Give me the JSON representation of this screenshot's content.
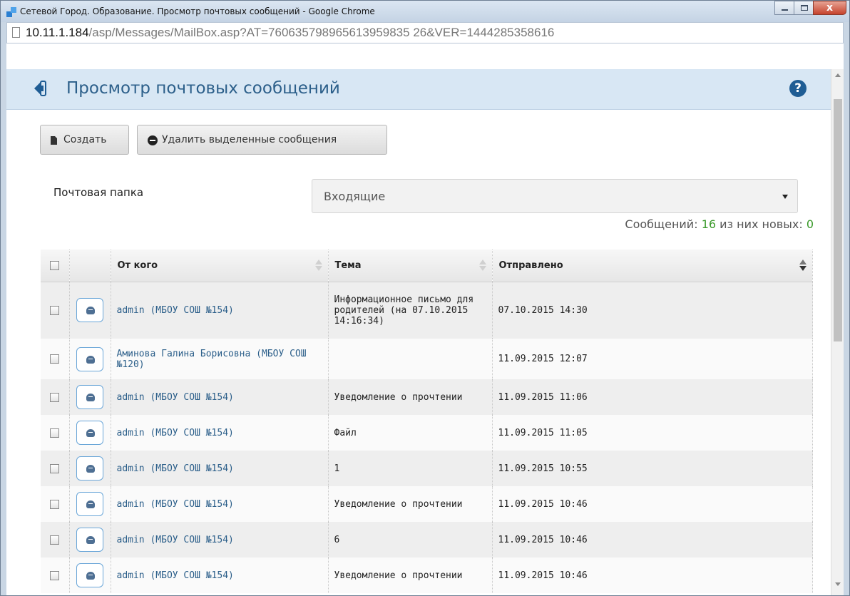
{
  "window": {
    "title": "Сетевой Город. Образование. Просмотр почтовых сообщений - Google Chrome"
  },
  "address": {
    "host": "10.11.1.184",
    "path": "/asp/Messages/MailBox.asp?AT=760635798965613959835 26&VER=1444285358616"
  },
  "page": {
    "title": "Просмотр почтовых сообщений",
    "help": "?"
  },
  "toolbar": {
    "create_label": "Создать",
    "delete_label": "Удалить выделенные сообщения"
  },
  "folder": {
    "label": "Почтовая папка",
    "selected": "Входящие"
  },
  "counts": {
    "messages_label": "Сообщений:",
    "messages_total": "16",
    "new_label": "из них новых:",
    "new_count": "0"
  },
  "table": {
    "columns": {
      "from": "От кого",
      "subject": "Тема",
      "sent": "Отправлено"
    },
    "rows": [
      {
        "from": "admin (МБОУ СОШ №154)",
        "subject": "Информационное письмо для родителей (на 07.10.2015 14:16:34)",
        "sent": "07.10.2015 14:30"
      },
      {
        "from": "Аминова Галина Борисовна (МБОУ СОШ №120)",
        "subject": "",
        "sent": "11.09.2015 12:07"
      },
      {
        "from": "admin (МБОУ СОШ №154)",
        "subject": "Уведомление о прочтении",
        "sent": "11.09.2015 11:06"
      },
      {
        "from": "admin (МБОУ СОШ №154)",
        "subject": "Файл",
        "sent": "11.09.2015 11:05"
      },
      {
        "from": "admin (МБОУ СОШ №154)",
        "subject": "1",
        "sent": "11.09.2015 10:55"
      },
      {
        "from": "admin (МБОУ СОШ №154)",
        "subject": "Уведомление о прочтении",
        "sent": "11.09.2015 10:46"
      },
      {
        "from": "admin (МБОУ СОШ №154)",
        "subject": "6",
        "sent": "11.09.2015 10:46"
      },
      {
        "from": "admin (МБОУ СОШ №154)",
        "subject": "Уведомление о прочтении",
        "sent": "11.09.2015 10:46"
      }
    ]
  },
  "colors": {
    "header_bg": "#d8e7f4",
    "title_color": "#2c5f8a",
    "count_green": "#3a9a2a"
  }
}
